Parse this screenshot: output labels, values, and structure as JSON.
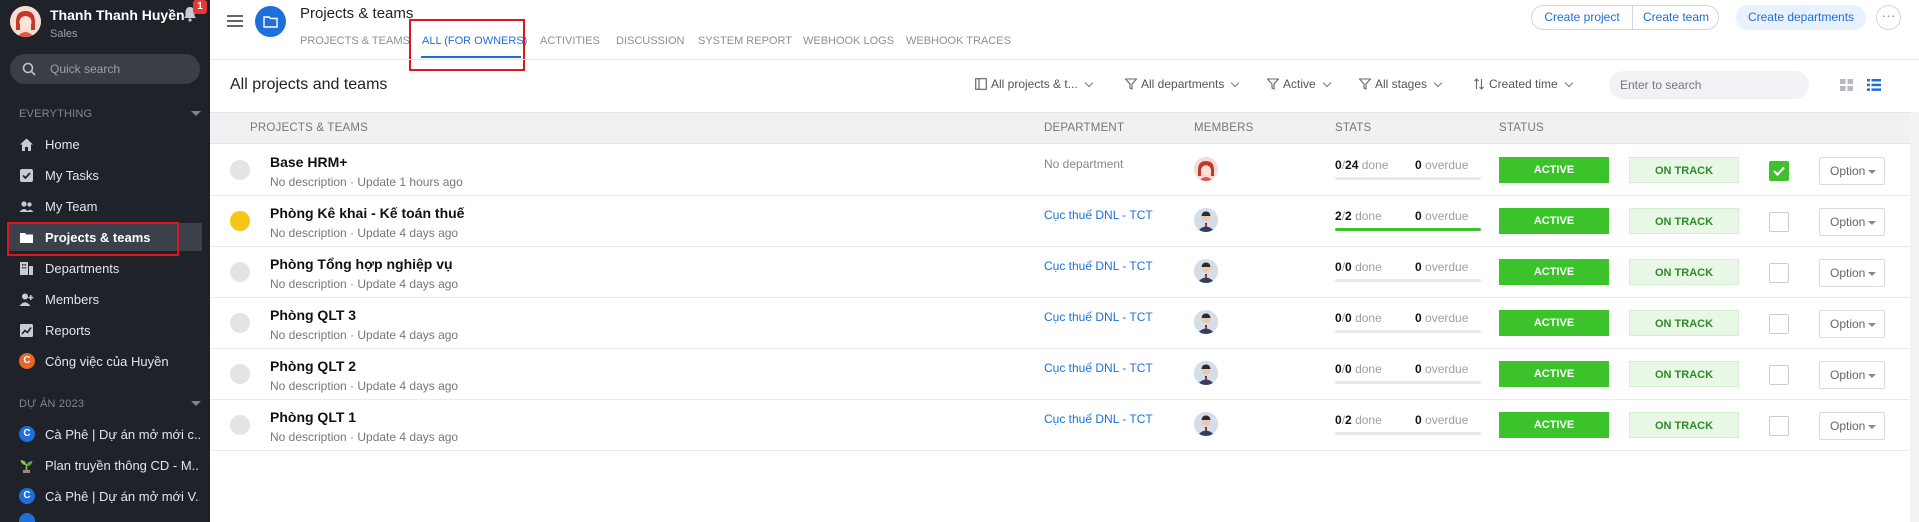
{
  "profile": {
    "name": "Thanh Thanh Huyền",
    "role": "Sales",
    "notifications": "1"
  },
  "sidebar": {
    "search_placeholder": "Quick search",
    "section_everything": "EVERYTHING",
    "items": [
      {
        "label": "Home",
        "icon": "home-icon"
      },
      {
        "label": "My Tasks",
        "icon": "checkbox-icon"
      },
      {
        "label": "My Team",
        "icon": "team-icon"
      },
      {
        "label": "Projects & teams",
        "icon": "folder-icon"
      },
      {
        "label": "Departments",
        "icon": "departments-icon"
      },
      {
        "label": "Members",
        "icon": "add-member-icon"
      },
      {
        "label": "Reports",
        "icon": "chart-icon"
      },
      {
        "label": "Công việc của Huyền",
        "icon": "c-badge-icon",
        "badge": "C"
      }
    ],
    "section_projects": "DỰ ÁN 2023",
    "projects": [
      {
        "label": "Cà Phê | Dự án mở mới c...",
        "badge": "C"
      },
      {
        "label": "Plan truyền thông CD - M...",
        "badge": ""
      },
      {
        "label": "Cà Phê | Dự án mở mới V...",
        "badge": "C"
      }
    ]
  },
  "header": {
    "title": "Projects & teams",
    "tabs": [
      "PROJECTS & TEAMS",
      "ALL (FOR OWNERS)",
      "ACTIVITIES",
      "DISCUSSION",
      "SYSTEM REPORT",
      "WEBHOOK LOGS",
      "WEBHOOK TRACES"
    ],
    "active_tab": "ALL (FOR OWNERS)",
    "btn_create_project": "Create project",
    "btn_create_team": "Create team",
    "btn_create_departments": "Create departments"
  },
  "toolbar": {
    "title": "All projects and teams",
    "filters": [
      "All projects & t...",
      "All departments",
      "Active",
      "All stages",
      "Created time"
    ],
    "search_placeholder": "Enter to search"
  },
  "table": {
    "headers": [
      "PROJECTS & TEAMS",
      "DEPARTMENT",
      "MEMBERS",
      "STATS",
      "STATUS"
    ],
    "done_label": "done",
    "overdue_label": "overdue",
    "option_label": "Option",
    "rows": [
      {
        "name": "Base HRM+",
        "desc": "No description · Update 1 hours ago",
        "department": "No department",
        "dept_link": false,
        "done": "0",
        "total": "24",
        "progress": 0,
        "overdue": "0",
        "status": "ACTIVE",
        "track": "ON TRACK",
        "checked": true,
        "dot": "gray",
        "avatar": "female"
      },
      {
        "name": "Phòng Kê khai - Kế toán thuế",
        "desc": "No description · Update 4 days ago",
        "department": "Cục thuế DNL - TCT",
        "dept_link": true,
        "done": "2",
        "total": "2",
        "progress": 1,
        "overdue": "0",
        "status": "ACTIVE",
        "track": "ON TRACK",
        "checked": false,
        "dot": "yellow",
        "avatar": "male"
      },
      {
        "name": "Phòng Tổng hợp nghiệp vụ",
        "desc": "No description · Update 4 days ago",
        "department": "Cục thuế DNL - TCT",
        "dept_link": true,
        "done": "0",
        "total": "0",
        "progress": 0,
        "overdue": "0",
        "status": "ACTIVE",
        "track": "ON TRACK",
        "checked": false,
        "dot": "gray",
        "avatar": "male"
      },
      {
        "name": "Phòng QLT 3",
        "desc": "No description · Update 4 days ago",
        "department": "Cục thuế DNL - TCT",
        "dept_link": true,
        "done": "0",
        "total": "0",
        "progress": 0,
        "overdue": "0",
        "status": "ACTIVE",
        "track": "ON TRACK",
        "checked": false,
        "dot": "gray",
        "avatar": "male"
      },
      {
        "name": "Phòng QLT 2",
        "desc": "No description · Update 4 days ago",
        "department": "Cục thuế DNL - TCT",
        "dept_link": true,
        "done": "0",
        "total": "0",
        "progress": 0,
        "overdue": "0",
        "status": "ACTIVE",
        "track": "ON TRACK",
        "checked": false,
        "dot": "gray",
        "avatar": "male"
      },
      {
        "name": "Phòng QLT 1",
        "desc": "No description · Update 4 days ago",
        "department": "Cục thuế DNL - TCT",
        "dept_link": true,
        "done": "0",
        "total": "2",
        "progress": 0,
        "overdue": "0",
        "status": "ACTIVE",
        "track": "ON TRACK",
        "checked": false,
        "dot": "gray",
        "avatar": "male"
      }
    ]
  },
  "colors": {
    "accent": "#1e6fd9",
    "active_green": "#3cc32b",
    "sidebar_bg": "#1f2329",
    "highlight_red": "#e0161e"
  }
}
